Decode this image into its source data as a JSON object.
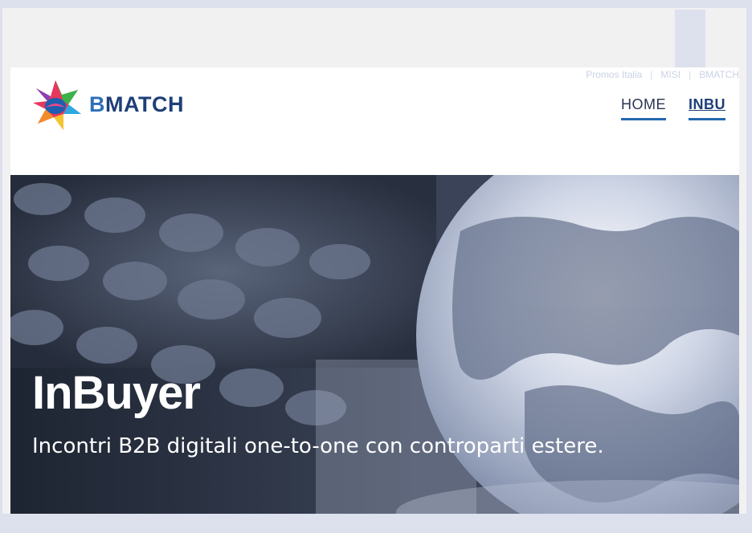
{
  "utility_bar": {
    "items": [
      "Promos Italia",
      "MISI",
      "BMATCH"
    ]
  },
  "logo": {
    "text_first": "B",
    "text_rest": "MATCH"
  },
  "nav": {
    "items": [
      {
        "label": "HOME"
      },
      {
        "label": "INBU"
      }
    ]
  },
  "hero": {
    "title": "InBuyer",
    "subtitle": "Incontri B2B digitali one-to-one con controparti estere."
  }
}
